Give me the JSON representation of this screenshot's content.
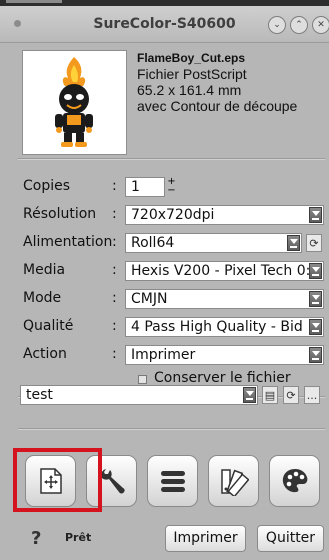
{
  "window": {
    "title": "SureColor-S40600"
  },
  "file": {
    "name": "FlameBoy_Cut.eps",
    "type": "Fichier PostScript",
    "size": "65.2 x 161.4 mm",
    "note": "avec Contour de découpe"
  },
  "form": {
    "copies_label": "Copies",
    "copies_value": "1",
    "resolution_label": "Résolution",
    "resolution_value": "720x720dpi",
    "feed_label": "Alimentation",
    "feed_value": "Roll64",
    "media_label": "Media",
    "media_value": "Hexis V200 - Pixel Tech 0:",
    "mode_label": "Mode",
    "mode_value": "CMJN",
    "quality_label": "Qualité",
    "quality_value": "4 Pass High Quality - Bid",
    "action_label": "Action",
    "action_value": "Imprimer",
    "keep_file_label": "Conserver le fichier Rippé",
    "keep_file_checked": false,
    "colon": ":"
  },
  "preset": {
    "value": "test",
    "more_label": "..."
  },
  "toolbar": {
    "items": [
      "layout-icon",
      "wrench-icon",
      "list-icon",
      "color-swatches-icon",
      "palette-icon"
    ]
  },
  "footer": {
    "help": "?",
    "status": "Prêt",
    "print_label": "Imprimer",
    "quit_label": "Quitter"
  },
  "colors": {
    "highlight": "#d4131f",
    "window_bg": "#b6b6b6"
  }
}
